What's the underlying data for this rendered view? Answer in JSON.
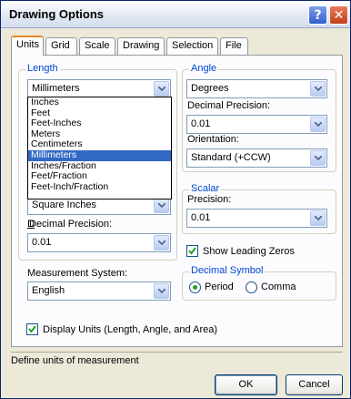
{
  "window": {
    "title": "Drawing Options"
  },
  "tabs": [
    "Units",
    "Grid",
    "Scale",
    "Drawing",
    "Selection",
    "File"
  ],
  "length": {
    "group_label": "Length",
    "selected": "Millimeters",
    "options": [
      "Inches",
      "Feet",
      "Feet-Inches",
      "Meters",
      "Centimeters",
      "Millimeters",
      "Inches/Fraction",
      "Feet/Fraction",
      "Feet-Inch/Fraction"
    ],
    "area_value": "Square Inches",
    "decimal_precision_label": "Decimal Precision:",
    "decimal_precision_value": "0.01"
  },
  "angle": {
    "group_label": "Angle",
    "selected": "Degrees",
    "decimal_precision_label": "Decimal Precision:",
    "decimal_precision_value": "0.01",
    "orientation_label": "Orientation:",
    "orientation_value": "Standard (+CCW)"
  },
  "scalar": {
    "group_label": "Scalar",
    "precision_label": "Precision:",
    "precision_value": "0.01"
  },
  "show_leading_zeros": {
    "label": "Show Leading Zeros",
    "checked": true
  },
  "measurement_system": {
    "label": "Measurement System:",
    "value": "English"
  },
  "decimal_symbol": {
    "group_label": "Decimal Symbol",
    "period_label": "Period",
    "comma_label": "Comma",
    "selected": "Period"
  },
  "display_units": {
    "label": "Display Units (Length, Angle, and Area)",
    "checked": true
  },
  "status": "Define units of measurement",
  "buttons": {
    "ok": "OK",
    "cancel": "Cancel"
  }
}
